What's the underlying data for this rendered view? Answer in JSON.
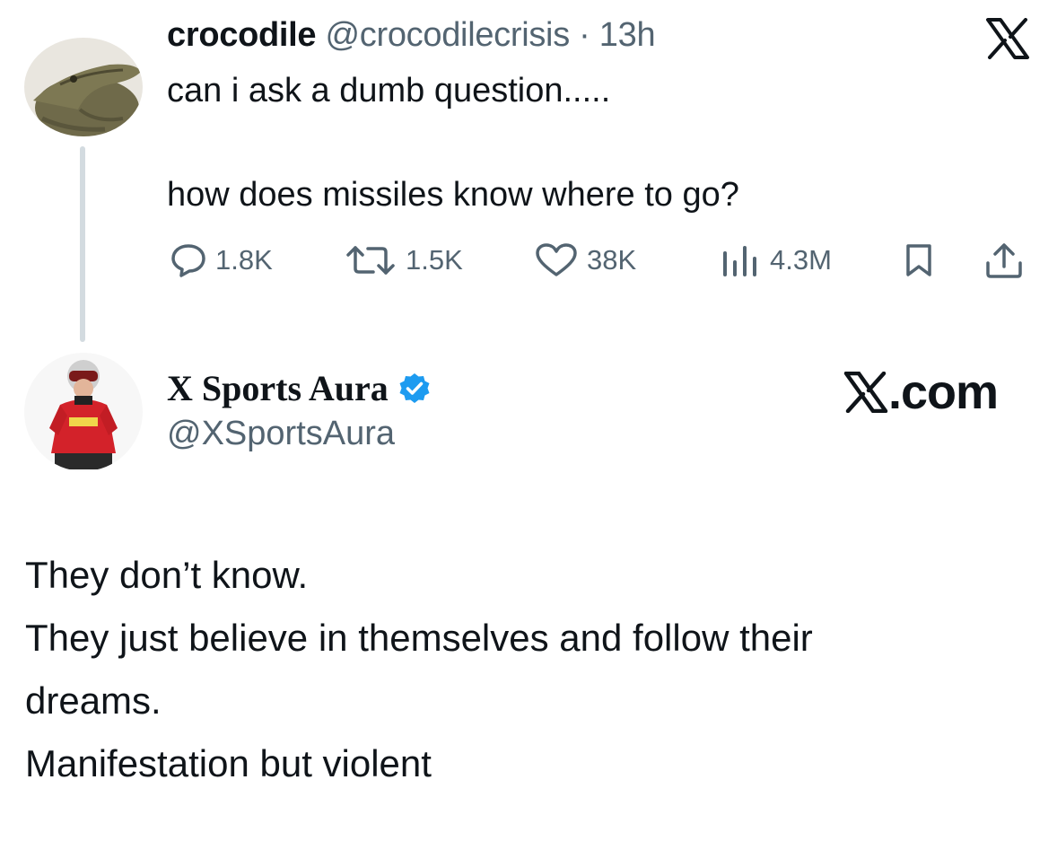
{
  "quoted_tweet": {
    "display_name": "crocodile",
    "handle": "@crocodilecrisis",
    "separator": "·",
    "time": "13h",
    "line1": "can i ask a dumb question.....",
    "line2": "how does missiles know where to go?",
    "avatar_icon": "crocodile-avatar",
    "platform_icon": "x-logo-icon",
    "actions": {
      "replies": "1.8K",
      "reposts": "1.5K",
      "likes": "38K",
      "views": "4.3M"
    }
  },
  "reply": {
    "display_name": "X Sports Aura",
    "handle": "@XSportsAura",
    "verified_color": "#1d9bf0",
    "avatar_icon": "racing-driver-avatar",
    "watermark": ".com",
    "lines": [
      "They don’t know.",
      "They just believe in themselves and follow their",
      "dreams.",
      "Manifestation but violent"
    ]
  },
  "colors": {
    "text": "#0f1419",
    "secondary": "#536471",
    "thread_line": "#d3dbe0"
  }
}
